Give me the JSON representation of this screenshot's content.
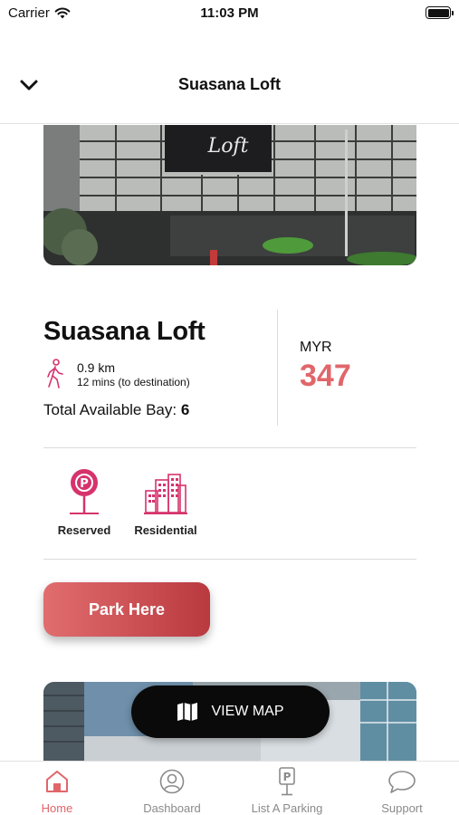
{
  "status_bar": {
    "carrier": "Carrier",
    "time": "11:03 PM"
  },
  "header": {
    "title": "Suasana Loft"
  },
  "hero": {
    "sign_text": "Loft"
  },
  "place": {
    "name": "Suasana Loft",
    "distance": "0.9 km",
    "duration": "12 mins (to destination)",
    "bays_label": "Total Available Bay:",
    "bays_value": "6",
    "currency": "MYR",
    "price": "347"
  },
  "features": [
    {
      "label": "Reserved",
      "icon": "parking-sign-icon"
    },
    {
      "label": "Residential",
      "icon": "buildings-icon"
    }
  ],
  "actions": {
    "park_here": "Park Here",
    "view_map": "VIEW MAP"
  },
  "tabs": [
    {
      "label": "Home",
      "icon": "home-icon",
      "active": true
    },
    {
      "label": "Dashboard",
      "icon": "user-icon",
      "active": false
    },
    {
      "label": "List A Parking",
      "icon": "parking-meter-icon",
      "active": false
    },
    {
      "label": "Support",
      "icon": "chat-bubble-icon",
      "active": false
    }
  ],
  "colors": {
    "accent": "#e0666a",
    "accent_dark": "#b9393f",
    "icon_pink": "#d6336c",
    "map_button": "#0a0a0a"
  }
}
